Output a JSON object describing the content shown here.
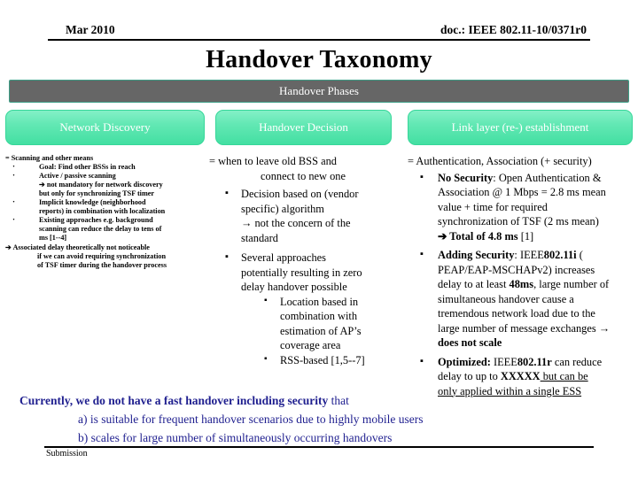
{
  "header": {
    "date": "Mar 2010",
    "doc": "doc.: IEEE 802.11-10/0371r0"
  },
  "title": "Handover Taxonomy",
  "phases_bar": {
    "label": "Handover Phases",
    "fill_color": "#666666",
    "border_color": "#3d9e86",
    "text_color": "#ffffff"
  },
  "phase_boxes": [
    {
      "label": "Network Discovery",
      "fill_color": "#4ee0a8",
      "text_color": "#ffffff"
    },
    {
      "label": "Handover Decision",
      "fill_color": "#4ee0a8",
      "text_color": "#ffffff"
    },
    {
      "label": "Link layer (re-) establishment",
      "fill_color": "#4ee0a8",
      "text_color": "#ffffff"
    }
  ],
  "columns": {
    "discovery": {
      "lead": "= Scanning and other means",
      "bullets": [
        {
          "bullet": "·",
          "lines": [
            "Goal: Find other BSSs in reach"
          ]
        },
        {
          "bullet": "·",
          "lines": [
            "Active / passive scanning",
            "➔ not mandatory for network discovery",
            "but only for synchronizing TSF timer"
          ]
        },
        {
          "bullet": "·",
          "lines": [
            "Implicit knowledge (neighborhood",
            "reports) in combination with localization"
          ]
        },
        {
          "bullet": "·",
          "lines": [
            "Existing approaches e.g. background",
            "scanning can reduce the delay to tens of",
            "ms [1--4]"
          ]
        }
      ],
      "tail": "➔ Associated delay theoretically not noticeable",
      "tail_lines": [
        "if we can avoid requiring synchronization",
        "of TSF timer during the handover process"
      ]
    },
    "decision": {
      "lead_line1": "= when to leave old BSS and",
      "lead_line2": "connect to new one",
      "bullets": [
        {
          "bullet": "▪",
          "lines": [
            "Decision based on (vendor",
            "specific) algorithm",
            "→ not the concern of the",
            "standard"
          ],
          "children": []
        },
        {
          "bullet": "▪",
          "lines": [
            "Several approaches",
            "potentially resulting in zero",
            "delay handover possible"
          ],
          "children": [
            {
              "bullet": "▪",
              "lines": [
                "Location based in",
                "combination with",
                "estimation of AP’s",
                "coverage area"
              ]
            },
            {
              "bullet": "▪",
              "lines": [
                "RSS-based [1,5--7]"
              ]
            }
          ]
        }
      ]
    },
    "link_layer": {
      "lead": "= Authentication, Association (+ security)",
      "bullets": [
        {
          "bullet": "▪",
          "strong": "No Security",
          "rest": ": Open Authentication &",
          "lines": [
            "Association @ 1 Mbps = 2.8 ms mean",
            "value + time for required",
            "synchronization of TSF (2 ms mean)"
          ],
          "arrow_strong": "➔ Total of 4.8 ms",
          "arrow_rest": " [1]"
        },
        {
          "bullet": "▪",
          "strong": "Adding Security",
          "rest": ": IEEE",
          "rest_strong": "802.11i",
          "rest2": " (",
          "lines": [
            "PEAP/EAP-MSCHAPv2) increases",
            "delay to at least ",
            "simultaneous handover cause a",
            "tremendous network load due to the",
            "large number of message exchanges →"
          ],
          "inline_strong_1": "48ms",
          "inline_after_1": ", large number of",
          "closing_strong": "does not scale"
        },
        {
          "bullet": "▪",
          "strong": "Optimized:",
          "rest": " IEEE",
          "rest_strong": "802.11r",
          "rest2": " can reduce",
          "line2_prefix": "delay to up to ",
          "line2_strong": "XXXXX",
          "line2_underline": " but can be",
          "line3_underline": "only applied within a single ESS"
        }
      ]
    }
  },
  "conclusion": {
    "strong": "Currently, we do not have a fast handover including security",
    "rest": " that",
    "item_a": "a) is suitable for frequent handover scenarios due to highly mobile users",
    "item_b": "b) scales for large number of simultaneously occurring handovers",
    "color": "#1f1f8f"
  },
  "footer": {
    "label": "Submission"
  }
}
